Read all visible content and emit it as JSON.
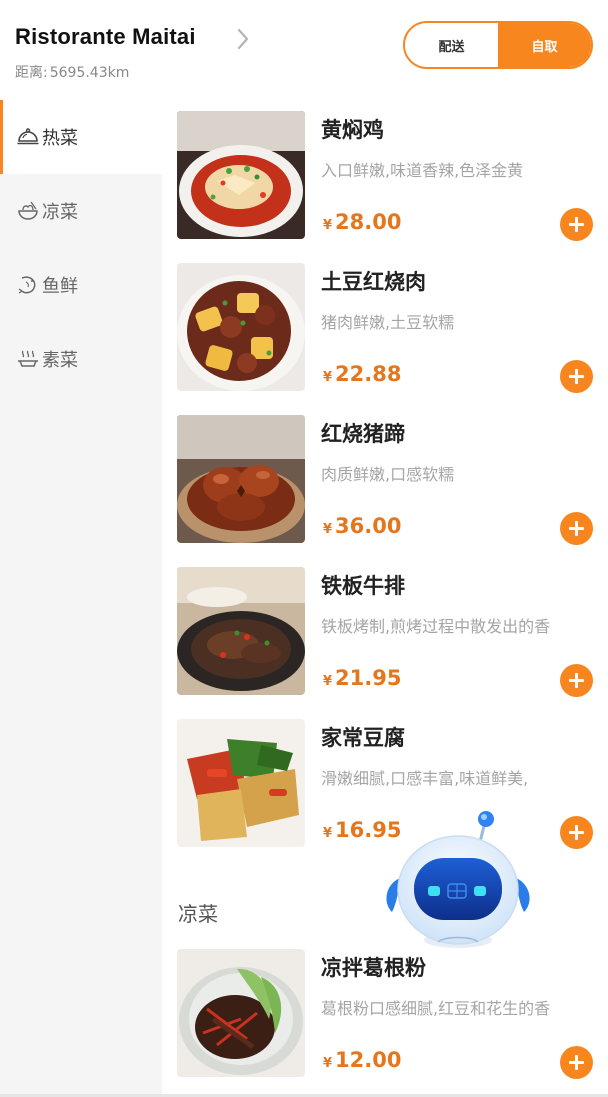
{
  "header": {
    "store_name": "Ristorante Maitai",
    "distance_label": "距离:",
    "distance_value": "5695.43km",
    "mode_delivery": "配送",
    "mode_pickup": "自取",
    "active_mode": "自取"
  },
  "colors": {
    "accent": "#F7861E",
    "price": "#E5761B",
    "sidebar_bg": "#f5f5f5"
  },
  "sidebar": {
    "items": [
      {
        "label": "热菜",
        "icon": "cloche-icon",
        "active": true
      },
      {
        "label": "凉菜",
        "icon": "bowl-icon",
        "active": false
      },
      {
        "label": "鱼鲜",
        "icon": "shrimp-icon",
        "active": false
      },
      {
        "label": "素菜",
        "icon": "steam-dish-icon",
        "active": false
      }
    ]
  },
  "menu": {
    "items": [
      {
        "name": "黄焖鸡",
        "desc": "入口鲜嫩,味道香辣,色泽金黄",
        "currency": "¥",
        "price": "28.00"
      },
      {
        "name": "土豆红烧肉",
        "desc": "猪肉鲜嫩,土豆软糯",
        "currency": "¥",
        "price": "22.88"
      },
      {
        "name": "红烧猪蹄",
        "desc": "肉质鲜嫩,口感软糯",
        "currency": "¥",
        "price": "36.00"
      },
      {
        "name": "铁板牛排",
        "desc": "铁板烤制,煎烤过程中散发出的香",
        "currency": "¥",
        "price": "21.95"
      },
      {
        "name": "家常豆腐",
        "desc": "滑嫩细腻,口感丰富,味道鲜美,",
        "currency": "¥",
        "price": "16.95"
      }
    ],
    "section_cold": "凉菜",
    "cold_items": [
      {
        "name": "凉拌葛根粉",
        "desc": "葛根粉口感细腻,红豆和花生的香",
        "currency": "¥",
        "price": "12.00"
      }
    ]
  },
  "assistant": {
    "icon": "robot-assistant-icon"
  }
}
